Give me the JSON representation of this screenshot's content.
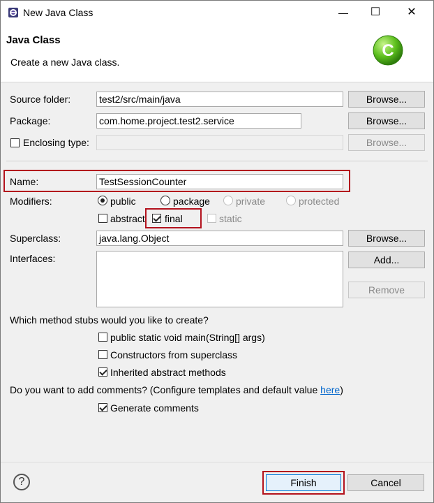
{
  "window": {
    "title": "New Java Class",
    "controls": {
      "minimize": "—",
      "maximize": "☐",
      "close": "✕"
    }
  },
  "banner": {
    "heading": "Java Class",
    "description": "Create a new Java class.",
    "icon_letter": "C"
  },
  "form": {
    "source_folder": {
      "label": "Source folder:",
      "value": "test2/src/main/java",
      "browse": "Browse..."
    },
    "package": {
      "label": "Package:",
      "value": "com.home.project.test2.service",
      "browse": "Browse..."
    },
    "enclosing_type": {
      "label": "Enclosing type:",
      "value": "",
      "browse": "Browse...",
      "checked": false
    },
    "name": {
      "label": "Name:",
      "value": "TestSessionCounter"
    },
    "modifiers": {
      "label": "Modifiers:",
      "access": [
        {
          "label": "public",
          "selected": true,
          "enabled": true
        },
        {
          "label": "package",
          "selected": false,
          "enabled": true
        },
        {
          "label": "private",
          "selected": false,
          "enabled": false
        },
        {
          "label": "protected",
          "selected": false,
          "enabled": false
        }
      ],
      "abstract": {
        "label": "abstract",
        "checked": false
      },
      "final": {
        "label": "final",
        "checked": true
      },
      "static": {
        "label": "static",
        "checked": false,
        "enabled": false
      }
    },
    "superclass": {
      "label": "Superclass:",
      "value": "java.lang.Object",
      "browse": "Browse..."
    },
    "interfaces": {
      "label": "Interfaces:",
      "add": "Add...",
      "remove": "Remove"
    },
    "stubs": {
      "question": "Which method stubs would you like to create?",
      "main": {
        "label": "public static void main(String[] args)",
        "checked": false
      },
      "constructors": {
        "label": "Constructors from superclass",
        "checked": false
      },
      "inherited": {
        "label": "Inherited abstract methods",
        "checked": true
      }
    },
    "comments": {
      "question": "Do you want to add comments? (Configure templates and default value ",
      "link": "here",
      "question_end": ")",
      "generate": {
        "label": "Generate comments",
        "checked": true
      }
    }
  },
  "footer": {
    "help": "?",
    "finish": "Finish",
    "cancel": "Cancel"
  },
  "colors": {
    "highlight": "#b3121d",
    "link": "#0066cc",
    "icon_green": "#4caf1a"
  }
}
